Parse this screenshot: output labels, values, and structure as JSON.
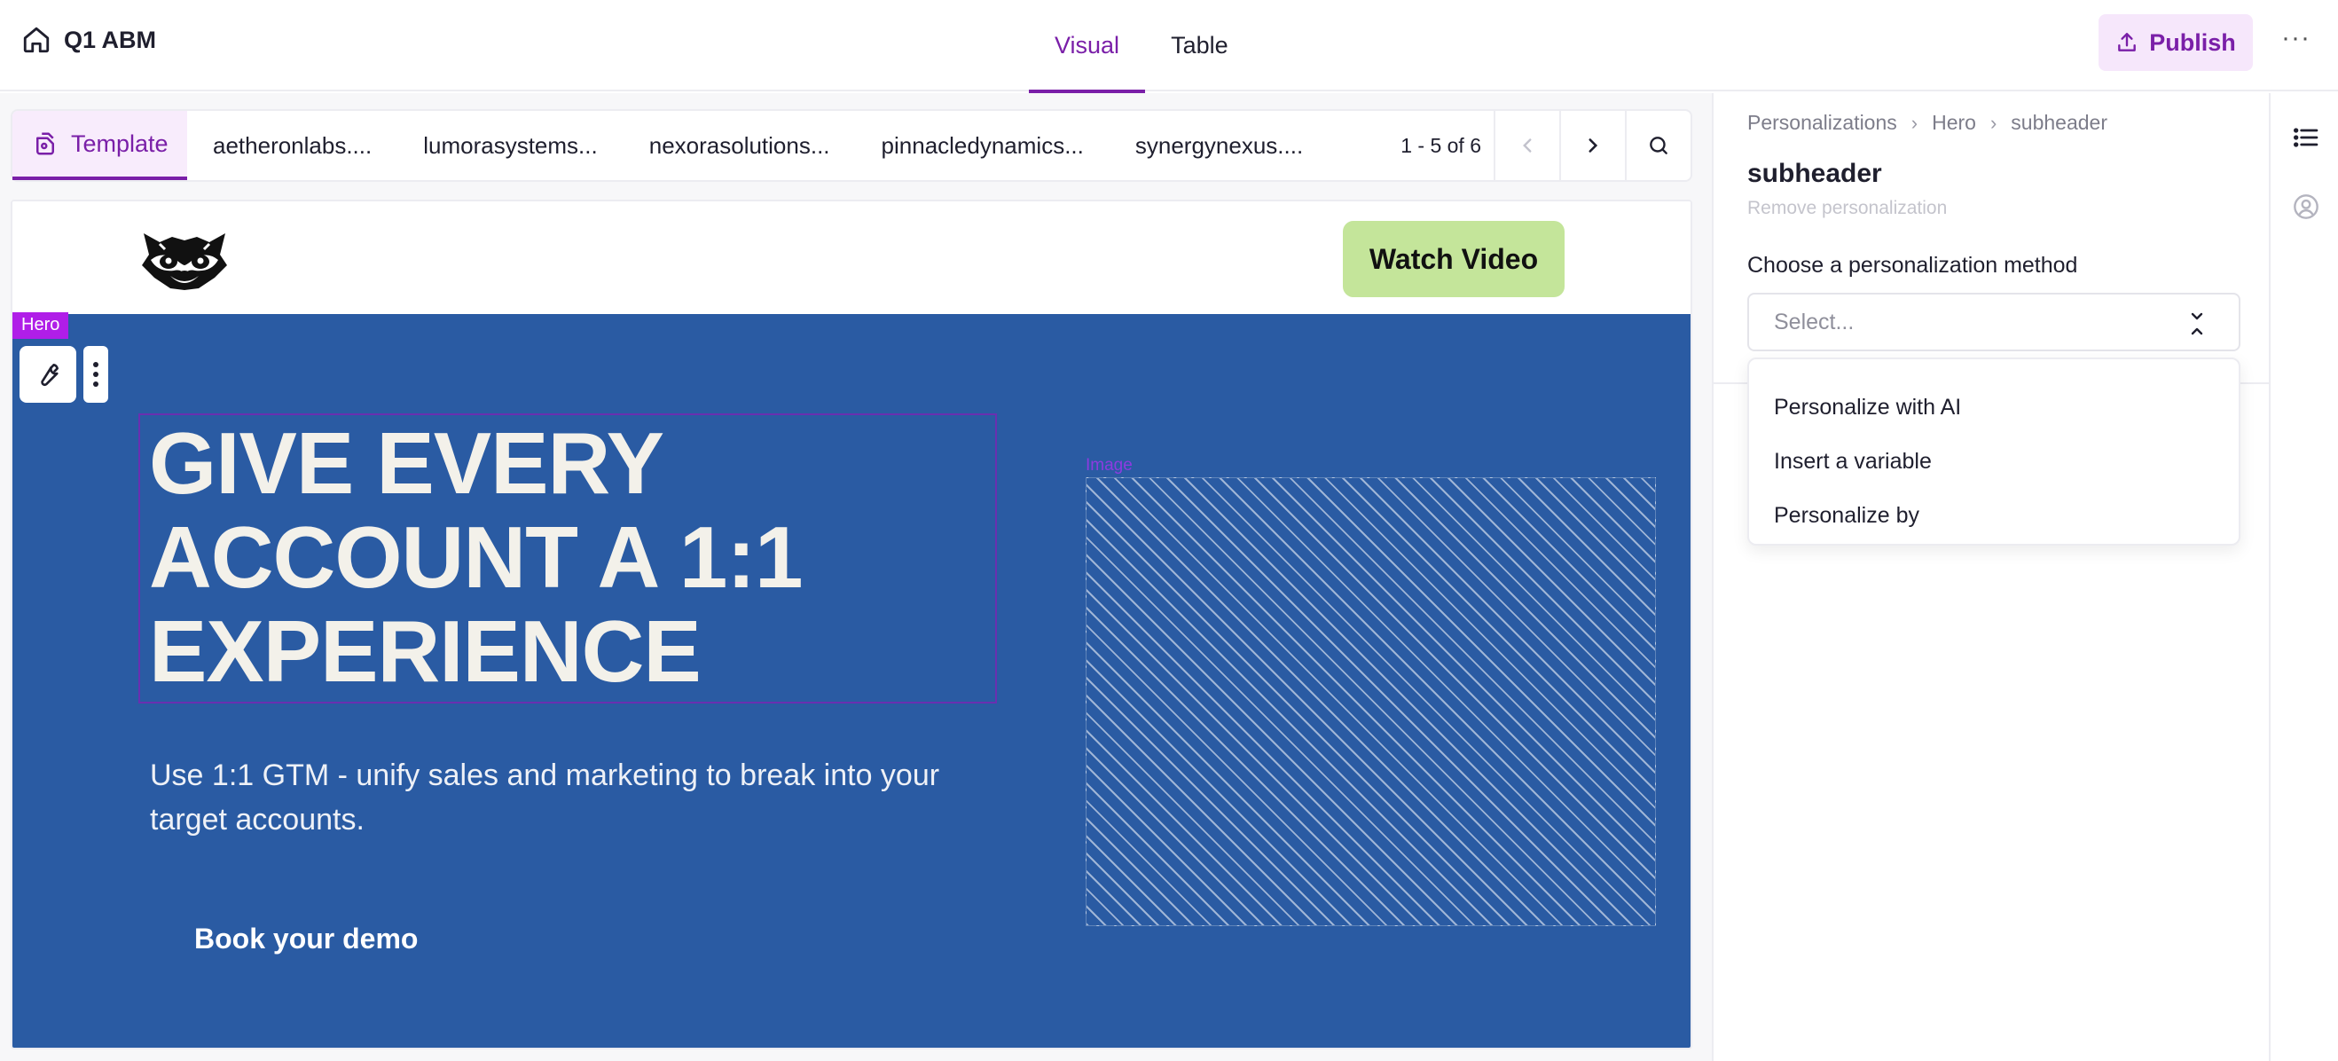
{
  "header": {
    "project_title": "Q1 ABM",
    "modes": [
      {
        "label": "Visual",
        "active": true
      },
      {
        "label": "Table",
        "active": false
      }
    ],
    "publish_label": "Publish",
    "more_label": "···"
  },
  "accounts_bar": {
    "template_label": "Template",
    "accounts": [
      "aetheronlabs....",
      "lumorasystems...",
      "nexorasolutions...",
      "pinnacledynamics...",
      "synergynexus...."
    ],
    "pagination": "1 - 5 of 6"
  },
  "page": {
    "nav_cta": "Watch Video",
    "hero_tag": "Hero",
    "headline": "GIVE EVERY ACCOUNT A 1:1 EXPERIENCE",
    "subheader": "Use 1:1 GTM - unify sales and marketing to break into your target accounts.",
    "cta": "Book your demo",
    "image_label": "Image"
  },
  "panel": {
    "breadcrumb": [
      "Personalizations",
      "Hero",
      "subheader"
    ],
    "title": "subheader",
    "remove_link": "Remove personalization",
    "method_label": "Choose a personalization method",
    "select_placeholder": "Select...",
    "options": [
      "Personalize with AI",
      "Insert a variable",
      "Personalize by"
    ]
  },
  "colors": {
    "accent": "#7a1fa8",
    "hero_bg": "#2a5ba3",
    "watch_btn": "#c4e59a",
    "hero_tag": "#b01ee8"
  }
}
